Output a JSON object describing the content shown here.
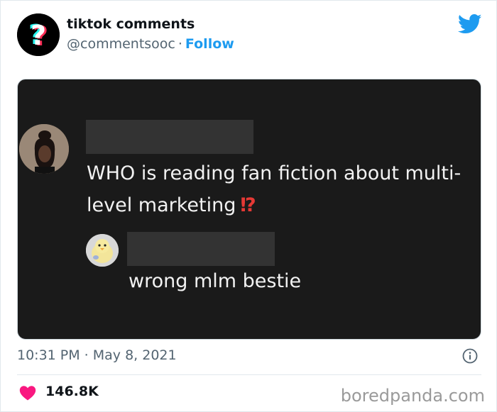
{
  "tweet": {
    "display_name": "tiktok comments",
    "handle": "@commentsooc",
    "separator": "·",
    "follow_label": "Follow",
    "timestamp": "10:31 PM · May 8, 2021",
    "likes": "146.8K"
  },
  "media": {
    "comment_text": "WHO is reading fan fiction about multi-level marketing",
    "comment_emoji": "⁉",
    "reply_text": "wrong mlm bestie"
  },
  "watermark": "boredpanda.com",
  "icons": {
    "profile": "question-mark-avatar-icon",
    "brand": "twitter-bird-icon",
    "info": "info-icon",
    "like": "heart-icon"
  },
  "colors": {
    "link_blue": "#1d9bf0",
    "twitter_blue": "#1d9bf0",
    "like_pink": "#f91880",
    "media_bg": "#1a1a1a",
    "emoji_red": "#e53935"
  }
}
